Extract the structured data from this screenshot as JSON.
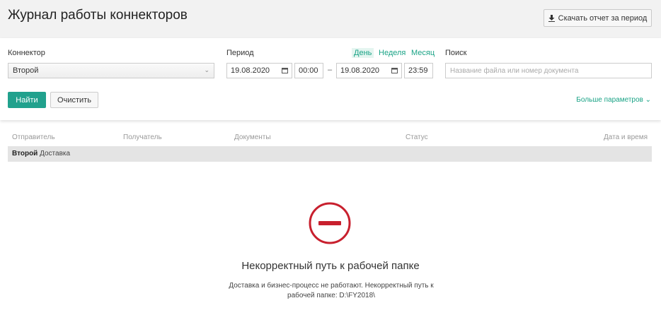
{
  "header": {
    "title": "Журнал работы коннекторов",
    "download_label": "Скачать отчет за период",
    "download_icon": "download-icon"
  },
  "filters": {
    "connector_label": "Коннектор",
    "connector_value": "Второй",
    "period_label": "Период",
    "period_links": [
      "День",
      "Неделя",
      "Месяц"
    ],
    "period_active": "День",
    "date_from": "19.08.2020",
    "time_from": "00:00",
    "range_separator": "–",
    "date_to": "19.08.2020",
    "time_to": "23:59",
    "search_label": "Поиск",
    "search_placeholder": "Название файла или номер документа",
    "find_label": "Найти",
    "clear_label": "Очистить",
    "more_label": "Больше параметров"
  },
  "table": {
    "columns": [
      "Отправитель",
      "Получатель",
      "Документы",
      "Статус",
      "Дата и время"
    ],
    "group_bold": "Второй",
    "group_rest": "Доставка"
  },
  "error": {
    "title": "Некорректный путь к рабочей папке",
    "text": "Доставка и бизнес-процесс не работают. Некорректный путь к рабочей папке: D:\\FY2018\\",
    "color": "#c8202e"
  },
  "colors": {
    "accent": "#21a18d",
    "link": "#1aa386"
  }
}
